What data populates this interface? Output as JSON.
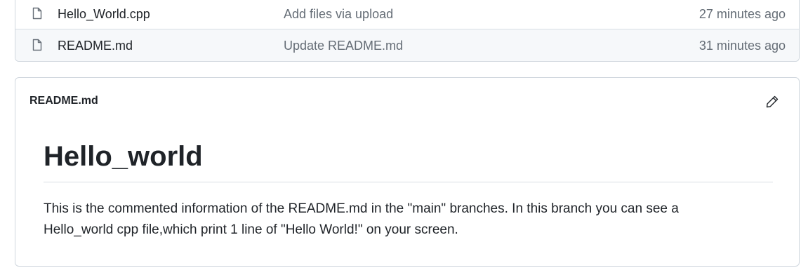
{
  "files": [
    {
      "icon": "file-icon",
      "name": "Hello_World.cpp",
      "commit_message": "Add files via upload",
      "age": "27 minutes ago"
    },
    {
      "icon": "file-icon",
      "name": "README.md",
      "commit_message": "Update README.md",
      "age": "31 minutes ago"
    }
  ],
  "readme": {
    "file_label": "README.md",
    "edit_icon": "pencil-icon",
    "heading": "Hello_world",
    "paragraph": "This is the commented information of the README.md in the \"main\" branches. In this branch you can see a Hello_world cpp file,which print 1 line of \"Hello World!\" on your screen."
  },
  "colors": {
    "text_primary": "#1f2328",
    "text_muted": "#656d76",
    "border": "#d0d7de",
    "row_hover": "#f6f8fa"
  }
}
